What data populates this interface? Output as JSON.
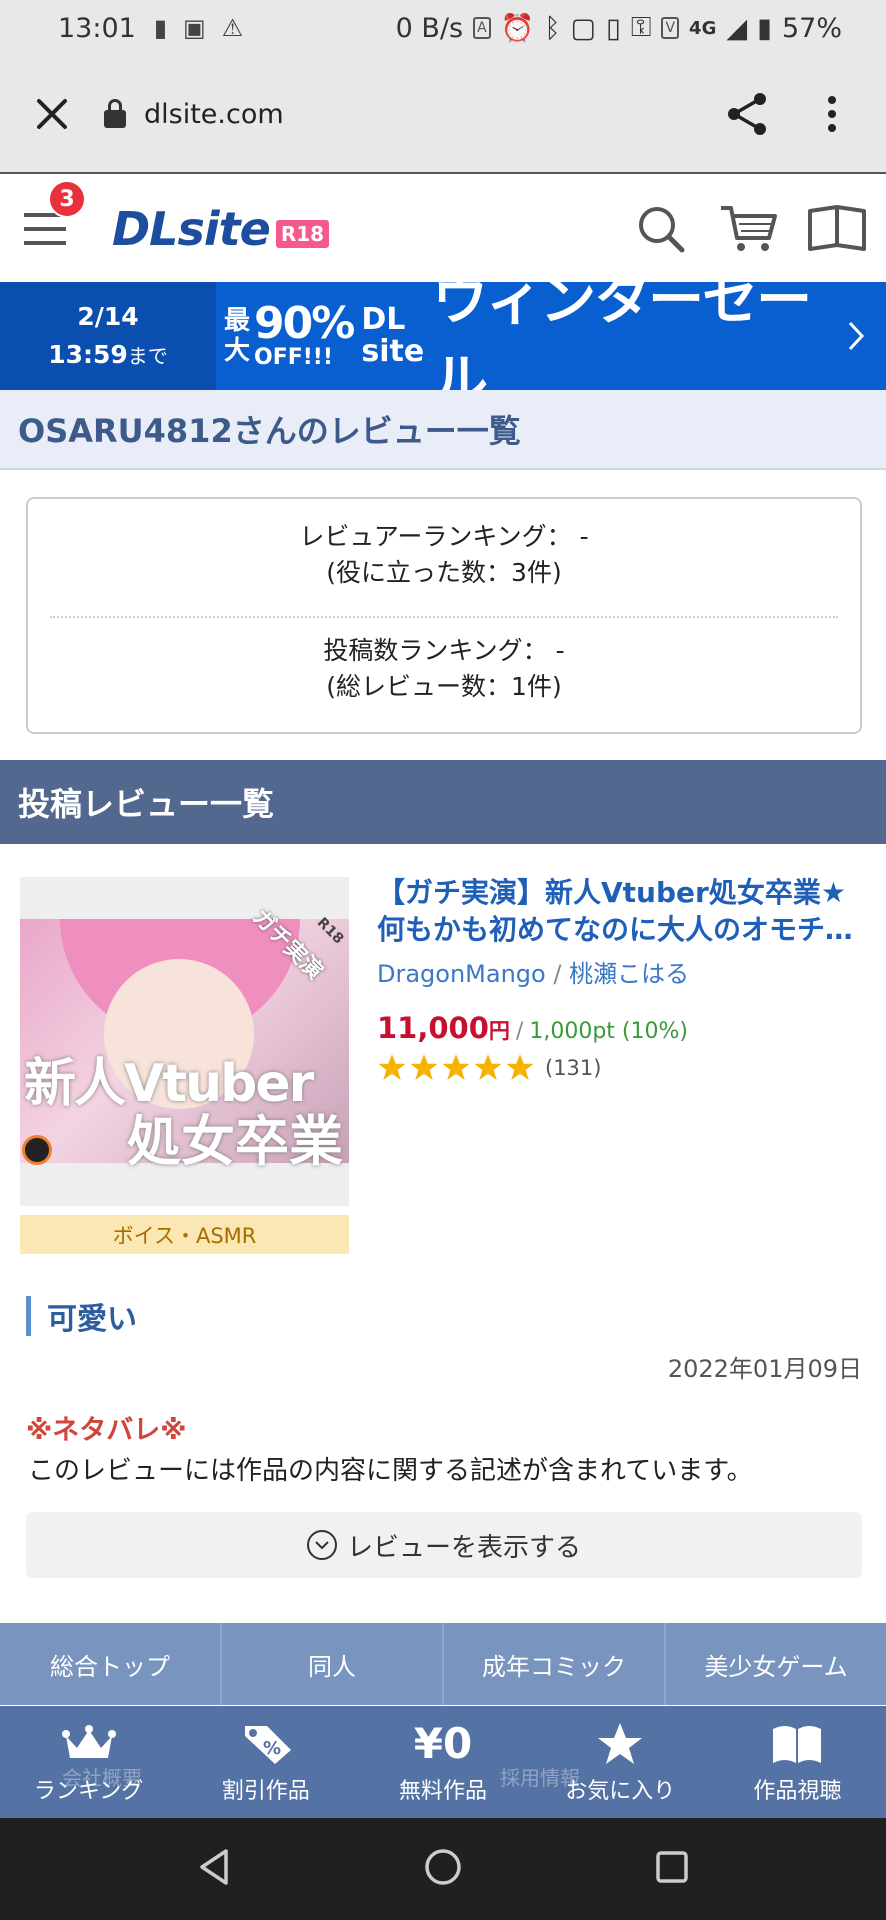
{
  "status_bar": {
    "time": "13:01",
    "net_speed": "0 B/s",
    "network": "4G",
    "battery": "57%"
  },
  "browser": {
    "url": "dlsite.com"
  },
  "header": {
    "menu_badge": "3",
    "logo_text": "DLsite",
    "logo_badge": "R18"
  },
  "sale_banner": {
    "date": "2/14",
    "time": "13:59",
    "until": "まで",
    "pct_prefix_1": "最",
    "pct_prefix_2": "大",
    "pct_value": "90%",
    "pct_off": "OFF!!!",
    "dl": "DL",
    "site": "site",
    "title": "ウィンターセール"
  },
  "page_title": "OSARU4812さんのレビュー一覧",
  "ranking": {
    "reviewer_rank": "レビュアーランキング： -",
    "helpful_count": "(役に立った数：3件)",
    "post_rank": "投稿数ランキング： -",
    "total_reviews": "(総レビュー数：1件)"
  },
  "section_title": "投稿レビュー一覧",
  "work": {
    "title_line1": "【ガチ実演】新人Vtuber処女卒業★",
    "title_line2": "何もかも初めてなのに大人のオモチャで",
    "maker": "DragonMango",
    "separator": "/",
    "author": "桃瀬こはる",
    "price": "11,000",
    "yen": "円",
    "price_sep": "/",
    "points": "1,000pt (10%)",
    "rating": 5,
    "rating_count": "(131)",
    "category": "ボイス・ASMR",
    "thumb_text1": "新人Vtuber",
    "thumb_text2": "処女卒業",
    "thumb_tag": "ガチ実演",
    "thumb_r18": "R18"
  },
  "review": {
    "title": "可愛い",
    "date": "2022年01月09日",
    "spoiler": "※ネタバレ※",
    "spoiler_desc": "このレビューには作品の内容に関する記述が含まれています。",
    "show_button": "レビューを表示する"
  },
  "footer_categories": [
    "総合トップ",
    "同人",
    "成年コミック",
    "美少女ゲーム"
  ],
  "bottom_nav": {
    "ranking": "ランキング",
    "discount": "割引作品",
    "free_icon": "¥0",
    "free": "無料作品",
    "favorite": "お気に入り",
    "viewer": "作品視聴",
    "ghost_left": "会社概要",
    "ghost_right": "採用情報"
  },
  "colors": {
    "brand_blue": "#1c4d9e",
    "sale_blue": "#0a5fd0",
    "section_header": "#52688f",
    "price_red": "#c8102e",
    "star_gold": "#f5b301"
  }
}
